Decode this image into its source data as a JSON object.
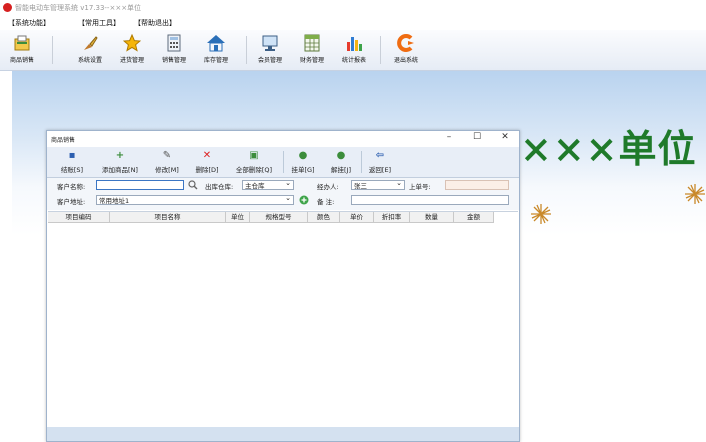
{
  "app": {
    "title": "智能电动车管理系统 v17.33--×××单位"
  },
  "menu": [
    "【系统功能】",
    "【常用工具】",
    "【帮助退出】"
  ],
  "toolbar": [
    {
      "label": "商品销售",
      "icon": "sales-icon"
    },
    {
      "label": "系统设置",
      "icon": "brush-settings-icon"
    },
    {
      "label": "进货管理",
      "icon": "star-icon"
    },
    {
      "label": "销售管理",
      "icon": "calculator-icon"
    },
    {
      "label": "库存管理",
      "icon": "house-icon"
    },
    {
      "label": "会员管理",
      "icon": "monitor-icon"
    },
    {
      "label": "财务管理",
      "icon": "spreadsheet-icon"
    },
    {
      "label": "统计报表",
      "icon": "bar-chart-icon"
    },
    {
      "label": "退出系统",
      "icon": "exit-icon"
    }
  ],
  "banner": {
    "text": "×××单位"
  },
  "window": {
    "title": "商品销售",
    "controls": {
      "minimize": "–",
      "maximize": "☐",
      "close": "✕"
    },
    "buttons": [
      {
        "label": "结账[S]",
        "icon": "save-icon"
      },
      {
        "label": "添加商品[N]",
        "icon": "add-item-icon"
      },
      {
        "label": "修改[M]",
        "icon": "edit-icon"
      },
      {
        "label": "删除[D]",
        "icon": "delete-icon"
      },
      {
        "label": "全部删除[Q]",
        "icon": "delete-all-icon"
      },
      {
        "label": "挂单[G]",
        "icon": "hold-order-icon"
      },
      {
        "label": "解挂[J]",
        "icon": "release-order-icon"
      },
      {
        "label": "返回[E]",
        "icon": "return-icon"
      }
    ],
    "form": {
      "customer_name_label": "客户名称:",
      "customer_name_value": "",
      "warehouse_label": "出库仓库:",
      "warehouse_value": "主仓库",
      "handler_label": "经办人:",
      "handler_value": "张三",
      "last_order_label": "上单号:",
      "last_order_value": "",
      "customer_address_label": "客户地址:",
      "customer_address_value": "常用地址1",
      "remark_label": "备  注:",
      "remark_value": ""
    },
    "grid_columns": [
      "项目编码",
      "项目名称",
      "单位",
      "规格型号",
      "颜色",
      "单价",
      "折扣率",
      "数量",
      "金额"
    ]
  },
  "colors": {
    "banner": "#1f7a2a",
    "accent": "#3b76c4",
    "star": "#d99a2b"
  }
}
